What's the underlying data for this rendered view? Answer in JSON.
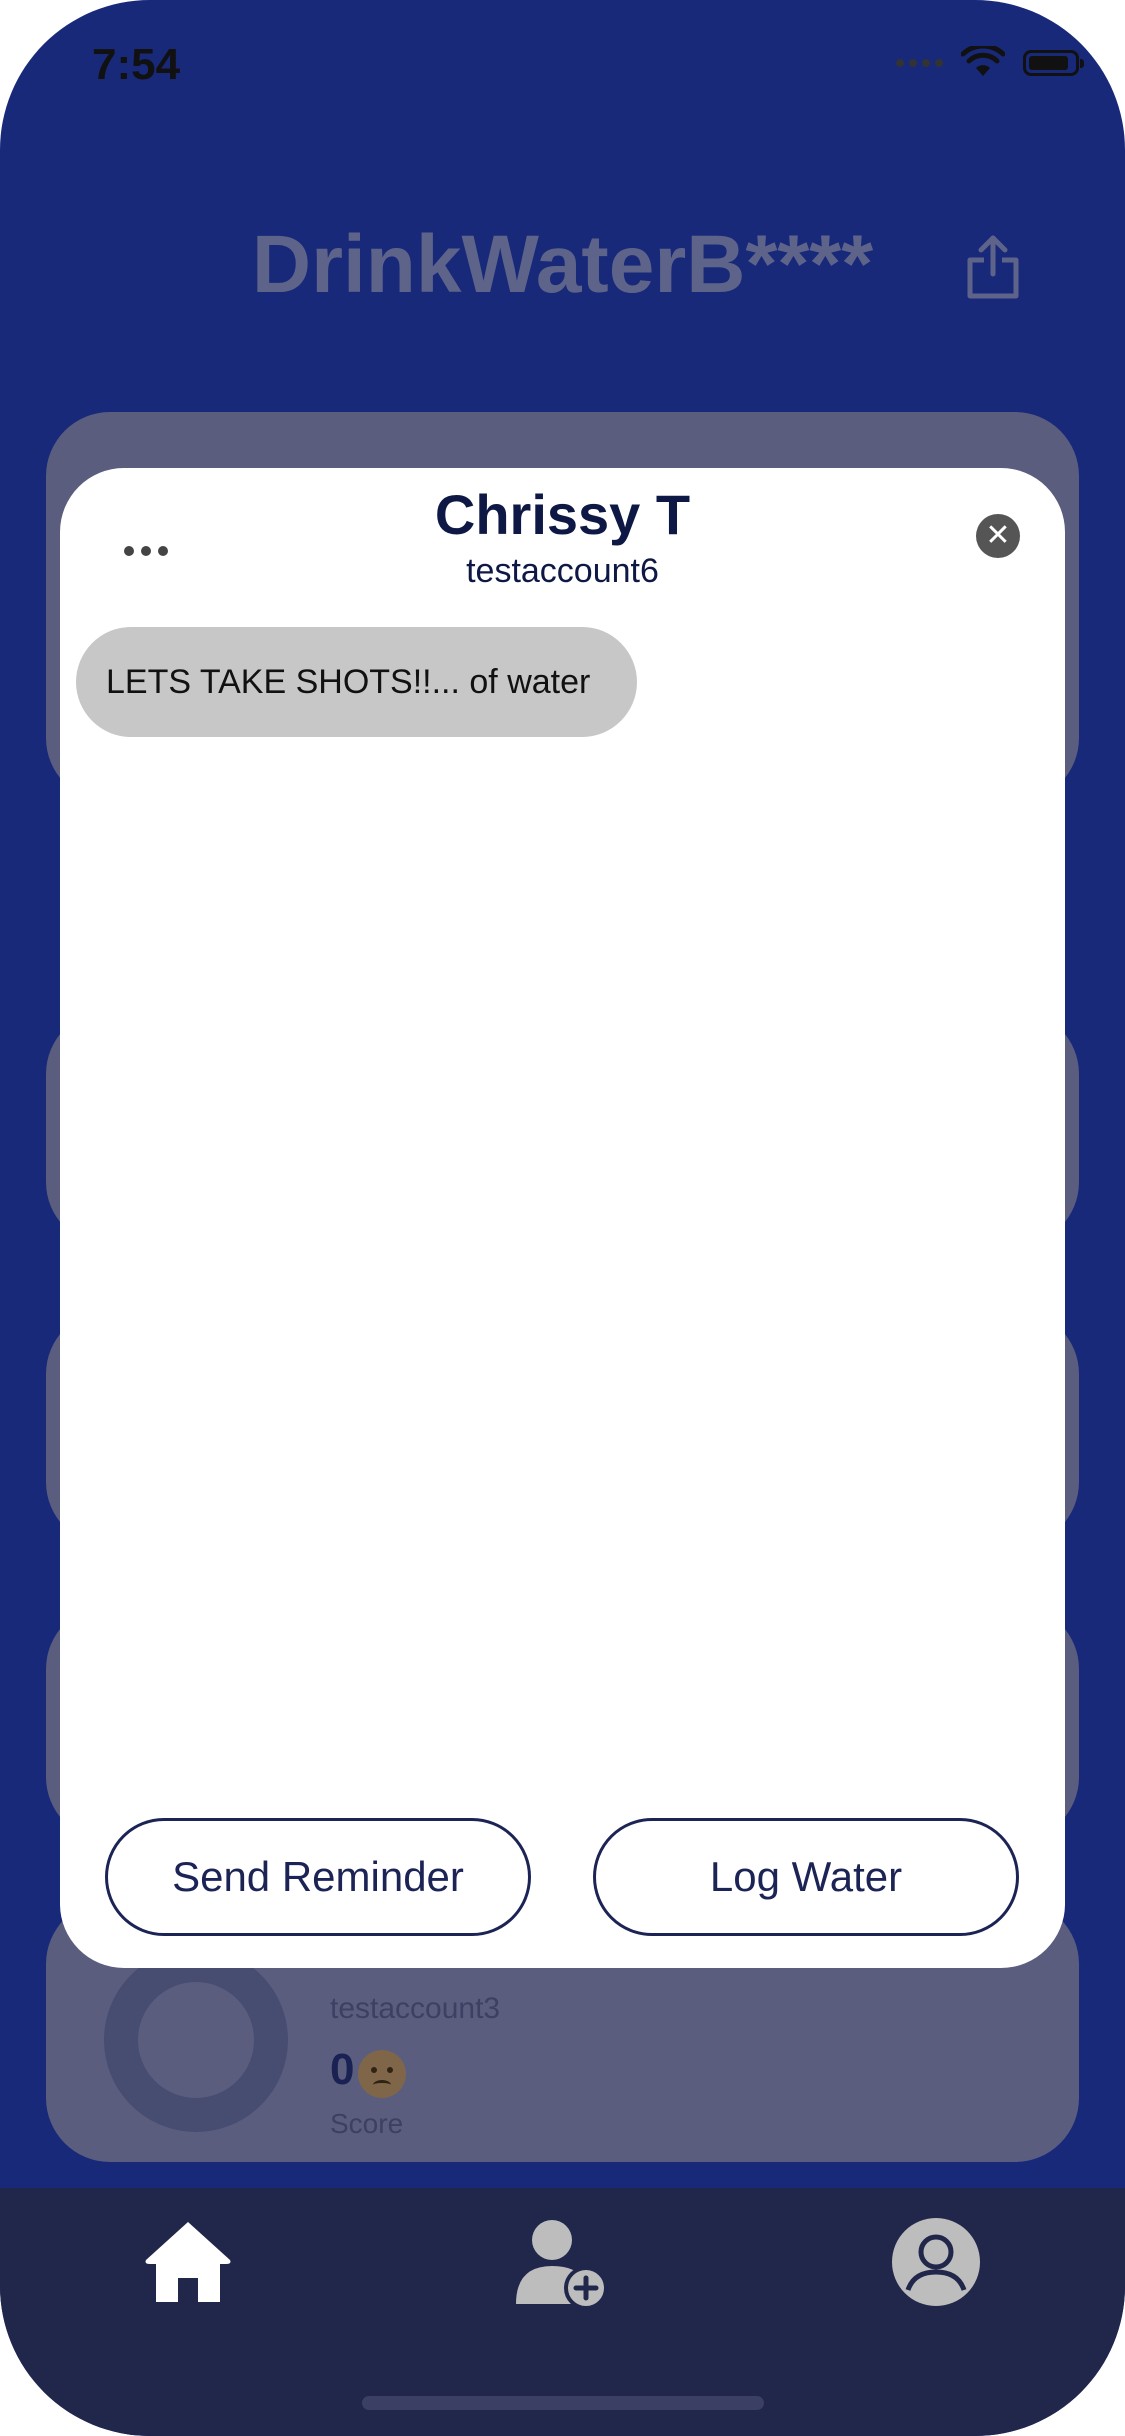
{
  "status_bar": {
    "time": "7:54",
    "icons": [
      "signal-icon",
      "wifi-icon",
      "battery-icon"
    ]
  },
  "header": {
    "app_title": "DrinkWaterB****",
    "share_icon": "share-icon"
  },
  "background_cards": {
    "larry": {
      "username": "testaccount3",
      "score": "0",
      "score_label": "Score",
      "mood_icon": "sad-face-icon"
    }
  },
  "modal": {
    "title": "Chrissy T",
    "subtitle": "testaccount6",
    "more_icon": "more-icon",
    "close_icon": "close-icon",
    "message": "LETS TAKE SHOTS!!... of water",
    "send_reminder_label": "Send Reminder",
    "log_water_label": "Log Water"
  },
  "tab_bar": {
    "items": [
      {
        "name": "home",
        "icon": "home-icon",
        "active": true
      },
      {
        "name": "add-friend",
        "icon": "add-friend-icon",
        "active": false
      },
      {
        "name": "profile",
        "icon": "profile-icon",
        "active": false
      }
    ]
  },
  "colors": {
    "background": "#18297a",
    "modal": "#ffffff",
    "text_dark": "#0e1845",
    "bubble": "#c7c7c7",
    "tab_bar": "#21264b"
  }
}
